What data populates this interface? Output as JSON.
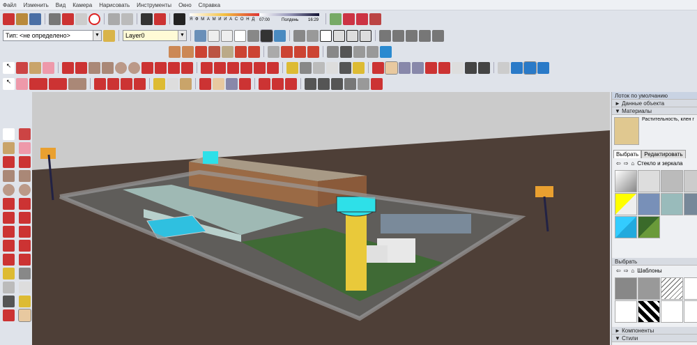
{
  "menu": [
    "Файл",
    "Изменить",
    "Вид",
    "Камера",
    "Нарисовать",
    "Инструменты",
    "Окно",
    "Справка"
  ],
  "shadow_bar": {
    "months": "Я Ф М А М И И А С О Н Д",
    "time_start": "07:00",
    "time_mid": "Полдень",
    "time_end": "16:29"
  },
  "entity_type": "Тип: <не определено>",
  "layer": "Layer0",
  "tray": {
    "title": "Лоток по умолчанию",
    "entity_info": "Данные объекта",
    "materials": "Материалы",
    "material_name": "Растительность, клен г",
    "tab_select": "Выбрать",
    "tab_edit": "Редактировать",
    "library": "Стекло и зеркала",
    "styles_select": "Выбрать",
    "styles_library": "Шаблоны",
    "components": "Компоненты",
    "styles": "Стили"
  },
  "colors": {
    "sky": "#cbcbcb",
    "ground": "#4e3f37",
    "lawn": "#3f6a35",
    "accent_cyan": "#2ee0e8",
    "tower_yellow": "#e9c93a"
  }
}
